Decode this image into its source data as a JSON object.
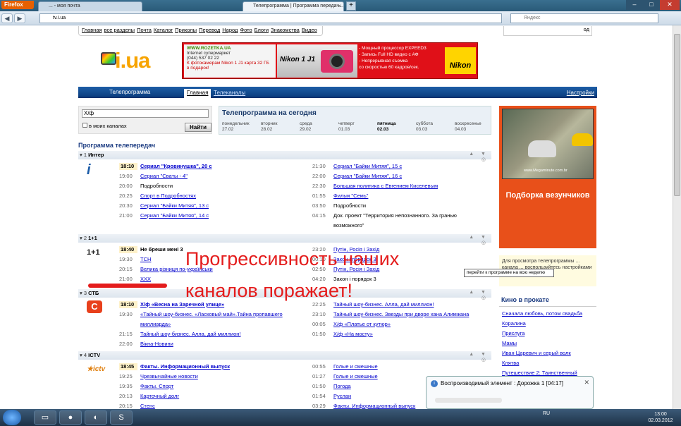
{
  "browser": {
    "app_button": "Firefox",
    "tabs": [
      {
        "label": "... - моя почта"
      },
      {
        "label": "Телепрограмма | Программа передач..."
      }
    ],
    "url": "tv.i.ua",
    "search_placeholder": "Яндекс"
  },
  "site": {
    "top_nav": [
      "Главная",
      "все разделы",
      "Почта",
      "Каталог",
      "Приколы",
      "Перевод",
      "Народ",
      "Фото",
      "Блоги",
      "Знакомства",
      "Видео"
    ],
    "login_link": "од",
    "logo_text": "i.ua",
    "banner": {
      "site": "WWW.ROZETKA.UA",
      "sub": "Internet супермаркет",
      "phone": "(044) 537 02 22",
      "promo": "К фотокамерам Nikon 1 J1 карта 32 ГБ в подарок!",
      "model": "Nikon 1 J1",
      "features": [
        "- Мощный процессор EXPEED3",
        "- Запись Full HD видео с АФ",
        "- Непрерывная съемка",
        "со скоростью 60 кадров/сек."
      ],
      "brand": "Nikon"
    },
    "section_title": "Телепрограмма",
    "tab_main": "Главная",
    "tab_channels": "Телеканалы",
    "settings_link": "Настройки",
    "search": {
      "value": "Х/ф",
      "checkbox_label": "в моих каналах",
      "button": "Найти"
    },
    "today": {
      "title": "Телепрограмма на сегодня",
      "days": [
        {
          "name": "понедельник",
          "date": "27.02"
        },
        {
          "name": "вторник",
          "date": "28.02"
        },
        {
          "name": "среда",
          "date": "29.02"
        },
        {
          "name": "четверг",
          "date": "01.03"
        },
        {
          "name": "пятница",
          "date": "02.03"
        },
        {
          "name": "суббота",
          "date": "03.03"
        },
        {
          "name": "воскресенье",
          "date": "04.03"
        }
      ]
    },
    "program_title": "Программа телепередач",
    "channels": [
      {
        "num": "1",
        "name": "Интер",
        "left": [
          {
            "time": "18:10",
            "title": "Сериал \"Кровинушка\", 20 с",
            "link": true
          },
          {
            "time": "19:00",
            "title": "Сериал \"Сваты - 4\"",
            "link": true
          },
          {
            "time": "20:00",
            "title": "Подробности",
            "link": false
          },
          {
            "time": "20:25",
            "title": "Спорт в Подробностях",
            "link": true
          },
          {
            "time": "20:30",
            "title": "Сериал \"Байки Митяя\", 13 с",
            "link": true
          },
          {
            "time": "21:00",
            "title": "Сериал \"Байки Митяя\", 14 с",
            "link": true
          }
        ],
        "right": [
          {
            "time": "21:30",
            "title": "Сериал \"Байки Митяя\", 15 с",
            "link": true
          },
          {
            "time": "22:00",
            "title": "Сериал \"Байки Митяя\", 16 с",
            "link": true
          },
          {
            "time": "22:30",
            "title": "Большая политика с Евгением Киселевым",
            "link": true
          },
          {
            "time": "01:55",
            "title": "Фильм \"Семь\"",
            "link": true
          },
          {
            "time": "03:50",
            "title": "Подробности",
            "link": false
          },
          {
            "time": "04:15",
            "title": "Док. проект \"Территория непознанного. За гранью",
            "link": false
          },
          {
            "time": "",
            "title": "возможного\"",
            "link": false
          }
        ]
      },
      {
        "num": "2",
        "name": "1+1",
        "left": [
          {
            "time": "18:40",
            "title": "Не бреши мені 3",
            "link": false
          },
          {
            "time": "19:30",
            "title": "ТСН",
            "link": true
          },
          {
            "time": "20:15",
            "title": "Велика різниця по-українськи",
            "link": true
          },
          {
            "time": "21:00",
            "title": "ХХХ",
            "link": true
          }
        ],
        "right": [
          {
            "time": "23:20",
            "title": "Путін, Росія і Захід",
            "link": true
          },
          {
            "time": "00:10",
            "title": "Закон і порядок 3",
            "link": true
          },
          {
            "time": "02:50",
            "title": "Путін, Росія і Захід",
            "link": true
          },
          {
            "time": "04:20",
            "title": "Закон і порядок 3",
            "link": false
          }
        ]
      },
      {
        "num": "3",
        "name": "СТБ",
        "left": [
          {
            "time": "18:10",
            "title": "Х/ф «Весна на Заречной улице»",
            "link": true
          },
          {
            "time": "19:30",
            "title": "«Тайный шоу-бизнес. «Ласковый май».Тайна пропавшего",
            "link": true
          },
          {
            "time": "",
            "title": "миллиарда»",
            "link": true
          },
          {
            "time": "21:15",
            "title": "Тайный шоу-бизнес. Алла, дай миллион!",
            "link": true
          },
          {
            "time": "22:00",
            "title": "Вікна-Новини",
            "link": true
          }
        ],
        "right": [
          {
            "time": "22:25",
            "title": "Тайный шоу-бизнес. Алла, дай миллион!",
            "link": true
          },
          {
            "time": "23:10",
            "title": "Тайный шоу-бизнес. Звезды при дворе хана Алимжана",
            "link": true
          },
          {
            "time": "00:05",
            "title": "Х/ф «Платье от кутюр»",
            "link": true
          },
          {
            "time": "01:50",
            "title": "Х/ф «На мосту»",
            "link": true
          }
        ]
      },
      {
        "num": "4",
        "name": "ICTV",
        "left": [
          {
            "time": "18:45",
            "title": "Факты. Информационный выпуск",
            "link": true
          },
          {
            "time": "19:25",
            "title": "Чрезвычайные новости",
            "link": true
          },
          {
            "time": "19:35",
            "title": "Факты. Спорт",
            "link": true
          },
          {
            "time": "20:13",
            "title": "Карточный долг",
            "link": true
          },
          {
            "time": "20:15",
            "title": "Стенс",
            "link": true
          }
        ],
        "right": [
          {
            "time": "00:55",
            "title": "Голые и смешные",
            "link": true
          },
          {
            "time": "01:27",
            "title": "Голые и смешные",
            "link": true
          },
          {
            "time": "01:50",
            "title": "Погода",
            "link": true
          },
          {
            "time": "01:54",
            "title": "Руслан",
            "link": true
          },
          {
            "time": "03:29",
            "title": "Факты. Информационный выпуск",
            "link": true
          }
        ]
      }
    ],
    "side_ad": {
      "caption": "Подборка везунчиков",
      "watermark": "www.Megaminute.com.br"
    },
    "side_note": "Для просмотра телепрограммы ... канала ... воспользуйтесь настройками",
    "tooltip": "перейти к программе на всю неделю",
    "movies": {
      "title": "Кино в прокате",
      "items": [
        "Сначала любовь, потом свадьба",
        "Коралина",
        "Прислуга",
        "Мамы",
        "Иван Царевич и серый волк",
        "Клятва",
        "Путешествие 2: Таинственный"
      ]
    },
    "overlay_text": "Прогрессивность наших каналов поражает!"
  },
  "notification": {
    "text": "Воспроизводимый элемент : Дорожка 1 [04:17]"
  },
  "taskbar": {
    "lang": "RU",
    "time": "13:00",
    "date": "02.03.2012"
  }
}
